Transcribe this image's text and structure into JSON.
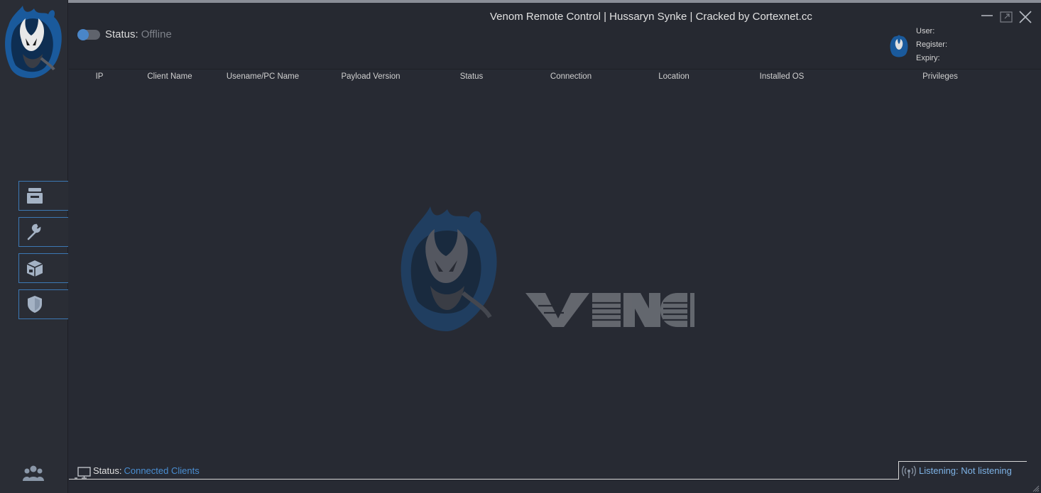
{
  "window": {
    "title": "Venom Remote Control | Hussaryn  Synke | Cracked by Cortexnet.cc",
    "minimize_icon": "minimize-icon",
    "maximize_icon": "maximize-icon",
    "close_icon": "close-icon"
  },
  "server_status": {
    "label": "Status:",
    "value": "Offline",
    "toggle_on": false
  },
  "user_panel": {
    "user_label": "User:",
    "register_label": "Register:",
    "expiry_label": "Expiry:"
  },
  "table": {
    "columns": [
      "IP",
      "Client Name",
      "Usename/PC Name",
      "Payload Version",
      "Status",
      "Connection",
      "Location",
      "Installed OS",
      "Privileges"
    ],
    "rows": []
  },
  "sidebar": {
    "items": [
      {
        "icon": "inbox-icon"
      },
      {
        "icon": "wrench-icon"
      },
      {
        "icon": "package-icon"
      },
      {
        "icon": "shield-icon"
      }
    ],
    "bottom_icon": "users-icon"
  },
  "watermark": {
    "text": "VENOM"
  },
  "statusbar": {
    "label": "Status:",
    "value": "Connected Clients",
    "listening": "Listening: Not listening"
  },
  "colors": {
    "background": "#272a33",
    "accent": "#4a86c8",
    "offline_text": "#7d8189",
    "listening_text": "#7eb3e6"
  }
}
